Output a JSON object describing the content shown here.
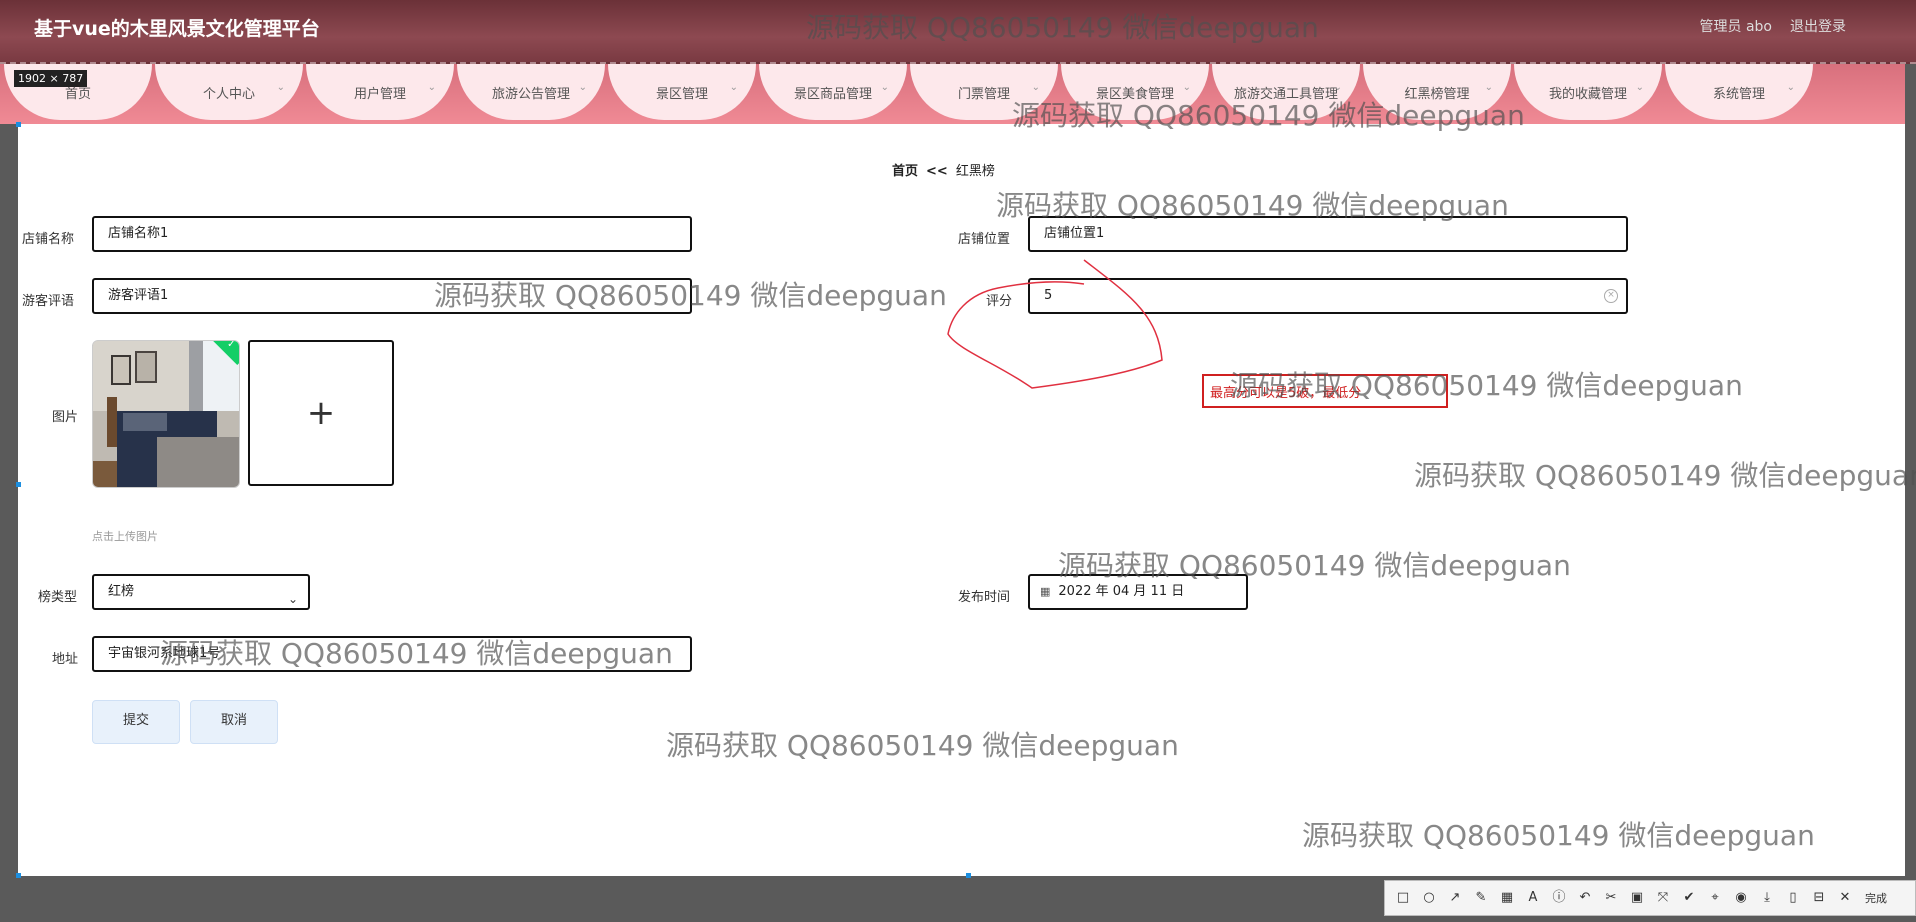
{
  "header": {
    "title": "基于vue的木里风景文化管理平台",
    "user": "管理员 abo",
    "logout": "退出登录"
  },
  "size_badge": "1902 × 787",
  "nav": {
    "items": [
      {
        "label": "首页",
        "has_dropdown": false
      },
      {
        "label": "个人中心",
        "has_dropdown": true
      },
      {
        "label": "用户管理",
        "has_dropdown": true
      },
      {
        "label": "旅游公告管理",
        "has_dropdown": true
      },
      {
        "label": "景区管理",
        "has_dropdown": true
      },
      {
        "label": "景区商品管理",
        "has_dropdown": true
      },
      {
        "label": "门票管理",
        "has_dropdown": true
      },
      {
        "label": "景区美食管理",
        "has_dropdown": true
      },
      {
        "label": "旅游交通工具管理",
        "has_dropdown": true
      },
      {
        "label": "红黑榜管理",
        "has_dropdown": true
      },
      {
        "label": "我的收藏管理",
        "has_dropdown": true
      },
      {
        "label": "系统管理",
        "has_dropdown": true
      }
    ]
  },
  "breadcrumb": {
    "home": "首页",
    "separator": "<<",
    "current": "红黑榜"
  },
  "form": {
    "shop_name": {
      "label": "店铺名称",
      "value": "店铺名称1"
    },
    "shop_location": {
      "label": "店铺位置",
      "value": "店铺位置1"
    },
    "review": {
      "label": "游客评语",
      "value": "游客评语1"
    },
    "rating": {
      "label": "评分",
      "value": "5"
    },
    "image": {
      "label": "图片",
      "upload_hint": "点击上传图片",
      "upload_symbol": "+"
    },
    "list_type": {
      "label": "榜类型",
      "value": "红榜"
    },
    "publish_time": {
      "label": "发布时间",
      "value": "2022 年 04 月 11 日"
    },
    "address": {
      "label": "地址",
      "value": "宇宙银河系地球1号"
    },
    "submit": "提交",
    "cancel": "取消"
  },
  "annotation": {
    "text": "最高分可以是5破，最低分"
  },
  "watermark": "源码获取 QQ86050149 微信deepguan",
  "snip_toolbar": {
    "tools": [
      "□",
      "○",
      "↗",
      "✎",
      "▦",
      "A",
      "ⓘ",
      "↶",
      "✂",
      "▣",
      "⤧",
      "✔",
      "⌖",
      "◉",
      "⤓",
      "▯",
      "⊟",
      "✕"
    ],
    "done": "完成"
  }
}
